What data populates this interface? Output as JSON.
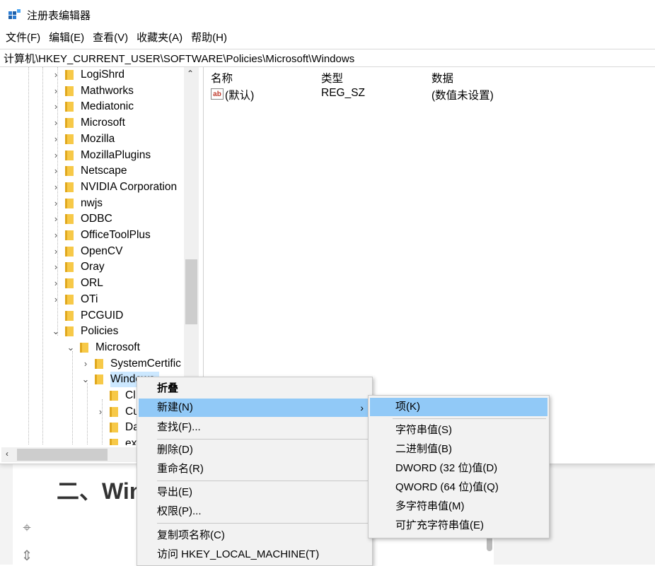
{
  "window": {
    "title": "注册表编辑器",
    "menu": [
      "文件(F)",
      "编辑(E)",
      "查看(V)",
      "收藏夹(A)",
      "帮助(H)"
    ],
    "address": "计算机\\HKEY_CURRENT_USER\\SOFTWARE\\Policies\\Microsoft\\Windows"
  },
  "tree": {
    "items": [
      {
        "label": "LogiShrd",
        "expander": "›"
      },
      {
        "label": "Mathworks",
        "expander": "›"
      },
      {
        "label": "Mediatonic",
        "expander": "›"
      },
      {
        "label": "Microsoft",
        "expander": "›"
      },
      {
        "label": "Mozilla",
        "expander": "›"
      },
      {
        "label": "MozillaPlugins",
        "expander": "›"
      },
      {
        "label": "Netscape",
        "expander": "›"
      },
      {
        "label": "NVIDIA Corporation",
        "expander": "›"
      },
      {
        "label": "nwjs",
        "expander": "›"
      },
      {
        "label": "ODBC",
        "expander": "›"
      },
      {
        "label": "OfficeToolPlus",
        "expander": "›"
      },
      {
        "label": "OpenCV",
        "expander": "›"
      },
      {
        "label": "Oray",
        "expander": "›"
      },
      {
        "label": "ORL",
        "expander": "›"
      },
      {
        "label": "OTi",
        "expander": "›"
      },
      {
        "label": "PCGUID",
        "expander": ""
      },
      {
        "label": "Policies",
        "expander": "⌄"
      },
      {
        "label": "Microsoft",
        "expander": "⌄"
      },
      {
        "label": "SystemCertific",
        "expander": "›"
      },
      {
        "label": "Windows",
        "expander": "⌄"
      },
      {
        "label": "Cl",
        "expander": ""
      },
      {
        "label": "Cu",
        "expander": "›"
      },
      {
        "label": "Da",
        "expander": ""
      },
      {
        "label": "ex",
        "expander": ""
      }
    ]
  },
  "values": {
    "headers": {
      "name": "名称",
      "type": "类型",
      "data": "数据"
    },
    "rows": [
      {
        "name": "(默认)",
        "type": "REG_SZ",
        "data": "(数值未设置)"
      }
    ]
  },
  "context_menu": {
    "items": [
      "折叠",
      "新建(N)",
      "查找(F)...",
      "删除(D)",
      "重命名(R)",
      "导出(E)",
      "权限(P)...",
      "复制项名称(C)",
      "访问 HKEY_LOCAL_MACHINE(T)"
    ],
    "submenu_arrow": "›"
  },
  "submenu": {
    "items": [
      "项(K)",
      "字符串值(S)",
      "二进制值(B)",
      "DWORD (32 位)值(D)",
      "QWORD (64 位)值(Q)",
      "多字符串值(M)",
      "可扩充字符串值(E)"
    ]
  },
  "background": {
    "heading": "二、Win"
  },
  "icons": {
    "app": "regedit-icon",
    "folder": "folder-icon",
    "value": "string-value-icon"
  }
}
